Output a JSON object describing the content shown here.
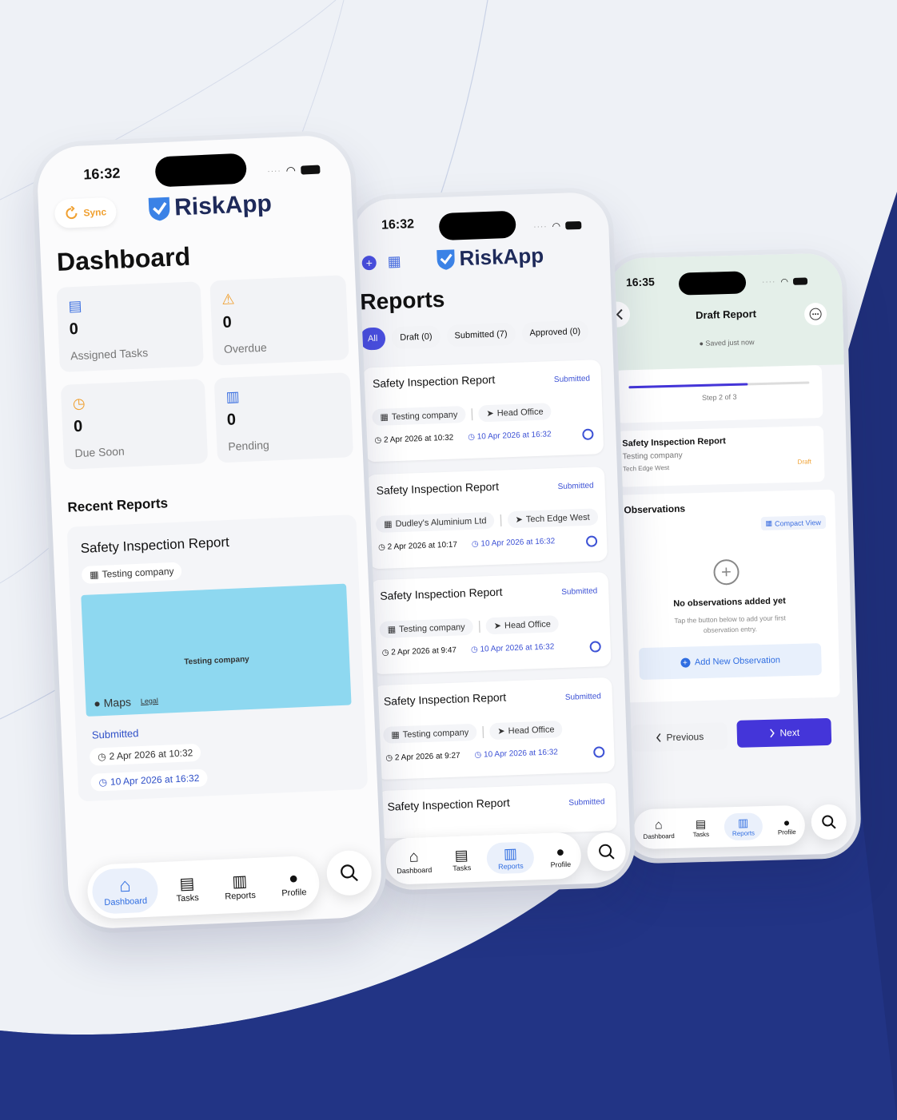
{
  "colors": {
    "accent": "#4a4fe0",
    "link_blue": "#3d52d5",
    "tab_active": "#2f6de1",
    "map_blue": "#8ed8f0",
    "orange": "#f0a030",
    "navy_bg": "#1f2f7a"
  },
  "phone1": {
    "time": "16:32",
    "sync_label": "Sync",
    "logo": "RiskApp",
    "title": "Dashboard",
    "stats": [
      {
        "icon": "clipboard-icon",
        "value": "0",
        "label": "Assigned Tasks"
      },
      {
        "icon": "warning-icon",
        "value": "0",
        "label": "Overdue"
      },
      {
        "icon": "clock-icon",
        "value": "0",
        "label": "Due Soon"
      },
      {
        "icon": "document-icon",
        "value": "0",
        "label": "Pending"
      }
    ],
    "recent_heading": "Recent Reports",
    "recent": {
      "title": "Safety Inspection Report",
      "company": "Testing company",
      "map_label": "Testing company",
      "maps_brand": "Maps",
      "maps_legal": "Legal",
      "status": "Submitted",
      "created": "2 Apr 2026 at 10:32",
      "due": "10 Apr 2026 at 16:32"
    },
    "tabs": [
      "Dashboard",
      "Tasks",
      "Reports",
      "Profile"
    ]
  },
  "phone2": {
    "time": "16:32",
    "logo": "RiskApp",
    "title": "Reports",
    "filters": [
      "All",
      "Draft (0)",
      "Submitted (7)",
      "Approved (0)"
    ],
    "reports": [
      {
        "title": "Safety Inspection Report",
        "status": "Submitted",
        "company": "Testing company",
        "location": "Head Office",
        "created": "2 Apr 2026 at 10:32",
        "due": "10 Apr 2026 at 16:32"
      },
      {
        "title": "Safety Inspection Report",
        "status": "Submitted",
        "company": "Dudley's Aluminium Ltd",
        "location": "Tech Edge West",
        "created": "2 Apr 2026 at 10:17",
        "due": "10 Apr 2026 at 16:32"
      },
      {
        "title": "Safety Inspection Report",
        "status": "Submitted",
        "company": "Testing company",
        "location": "Head Office",
        "created": "2 Apr 2026 at 9:47",
        "due": "10 Apr 2026 at 16:32"
      },
      {
        "title": "Safety Inspection Report",
        "status": "Submitted",
        "company": "Testing company",
        "location": "Head Office",
        "created": "2 Apr 2026 at 9:27",
        "due": "10 Apr 2026 at 16:32"
      },
      {
        "title": "Safety Inspection Report",
        "status": "Submitted"
      }
    ],
    "tabs": [
      "Dashboard",
      "Tasks",
      "Reports",
      "Profile"
    ]
  },
  "phone3": {
    "time": "16:35",
    "title": "Draft Report",
    "saved": "Saved just now",
    "step": "Step 2 of 3",
    "progress": 0.66,
    "report_title": "Safety Inspection Report",
    "company": "Testing company",
    "location": "Tech Edge West",
    "status": "Draft",
    "observations_heading": "Observations",
    "compact_view": "Compact View",
    "empty_title": "No observations added yet",
    "empty_sub1": "Tap the button below to add your first",
    "empty_sub2": "observation entry.",
    "add_button": "Add New Observation",
    "prev": "Previous",
    "next": "Next",
    "tabs": [
      "Dashboard",
      "Tasks",
      "Reports",
      "Profile"
    ]
  }
}
